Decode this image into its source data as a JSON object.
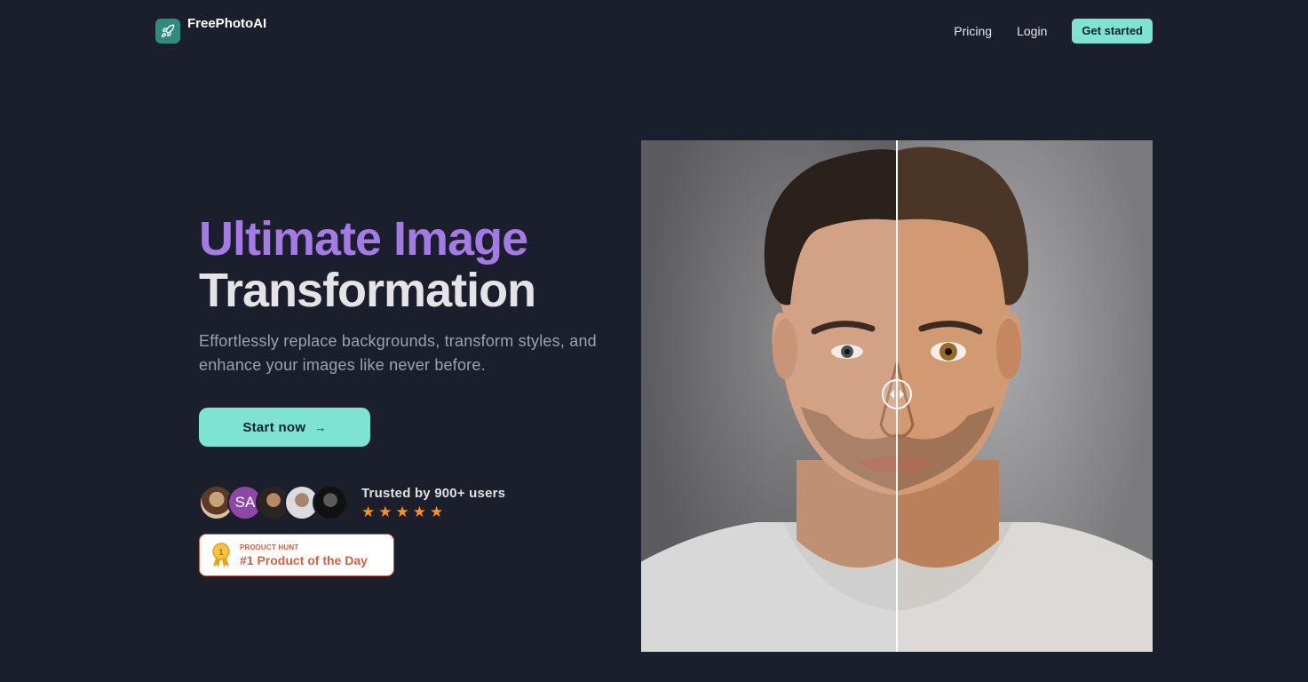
{
  "header": {
    "logo_text": "FreePhotoAI",
    "nav": {
      "pricing": "Pricing",
      "login": "Login",
      "get_started": "Get started"
    }
  },
  "hero": {
    "headline_line1": "Ultimate Image",
    "headline_line2": "Transformation",
    "subtitle": "Effortlessly replace backgrounds, transform styles, and enhance your images like never before.",
    "cta_label": "Start now",
    "cta_arrow": "→"
  },
  "social_proof": {
    "avatar_initials": "SA",
    "trusted_text": "Trusted by 900+ users",
    "rating_stars": 5,
    "star_glyph": "★"
  },
  "product_hunt": {
    "small_label": "PRODUCT HUNT",
    "title": "#1 Product of the Day",
    "medal_number": "1"
  },
  "comparison": {
    "slider_position": 0.5
  },
  "colors": {
    "background": "#1b1e2b",
    "accent": "#7de3d2",
    "headline_purple": "#a47ae5",
    "product_hunt": "#e05b3c",
    "star": "#f7931e"
  }
}
